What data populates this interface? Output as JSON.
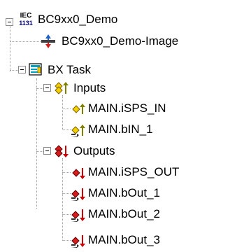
{
  "tree": {
    "root": {
      "label": "BC9xx0_Demo",
      "icon": "iec-1131-icon",
      "icon_text_top": "IEC",
      "icon_text_bottom": "1131"
    },
    "image": {
      "label": "BC9xx0_Demo-Image",
      "icon": "plc-image-icon"
    },
    "task": {
      "label": "BX Task",
      "icon": "task-icon"
    },
    "inputs": {
      "label": "Inputs",
      "icon": "inputs-folder-icon"
    },
    "input_items": [
      {
        "label": "MAIN.iSPS_IN",
        "icon": "input-variable-icon"
      },
      {
        "label": "MAIN.bIN_1",
        "icon": "linked-input-variable-icon"
      }
    ],
    "outputs": {
      "label": "Outputs",
      "icon": "outputs-folder-icon"
    },
    "output_items": [
      {
        "label": "MAIN.iSPS_OUT",
        "icon": "output-variable-icon"
      },
      {
        "label": "MAIN.bOut_1",
        "icon": "linked-output-variable-icon"
      },
      {
        "label": "MAIN.bOut_2",
        "icon": "linked-output-variable-icon"
      },
      {
        "label": "MAIN.bOut_3",
        "icon": "linked-output-variable-icon"
      }
    ]
  },
  "colors": {
    "input_arrow": "#808000",
    "output_arrow": "#cc0000",
    "task_icon": "#00a0c0",
    "iec_blue": "#000080"
  }
}
